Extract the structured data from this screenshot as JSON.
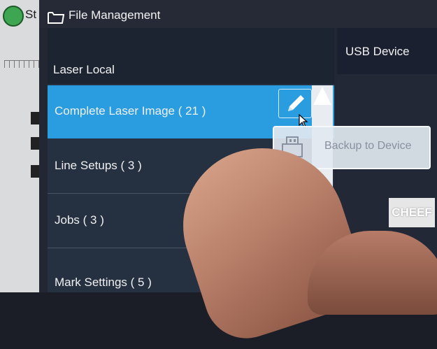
{
  "background": {
    "status_label": "St"
  },
  "dialog": {
    "title": "File Management",
    "icon": "folder-icon",
    "list": {
      "header": "Laser Local",
      "items": [
        {
          "label": "Complete Laser Image ( 21 )",
          "selected": true
        },
        {
          "label": "Line Setups ( 3 )",
          "selected": false
        },
        {
          "label": "Jobs ( 3 )",
          "selected": false
        },
        {
          "label": "Mark Settings ( 5 )",
          "selected": false
        }
      ],
      "edit_icon": "pencil-icon"
    },
    "right_panel": {
      "title": "USB Device"
    },
    "popup": {
      "label": "Backup to Device",
      "icon": "usb-icon"
    }
  },
  "watermark": "CHEEF",
  "colors": {
    "selected": "#2a9de0",
    "panel": "#253041",
    "dialog": "#232733"
  }
}
